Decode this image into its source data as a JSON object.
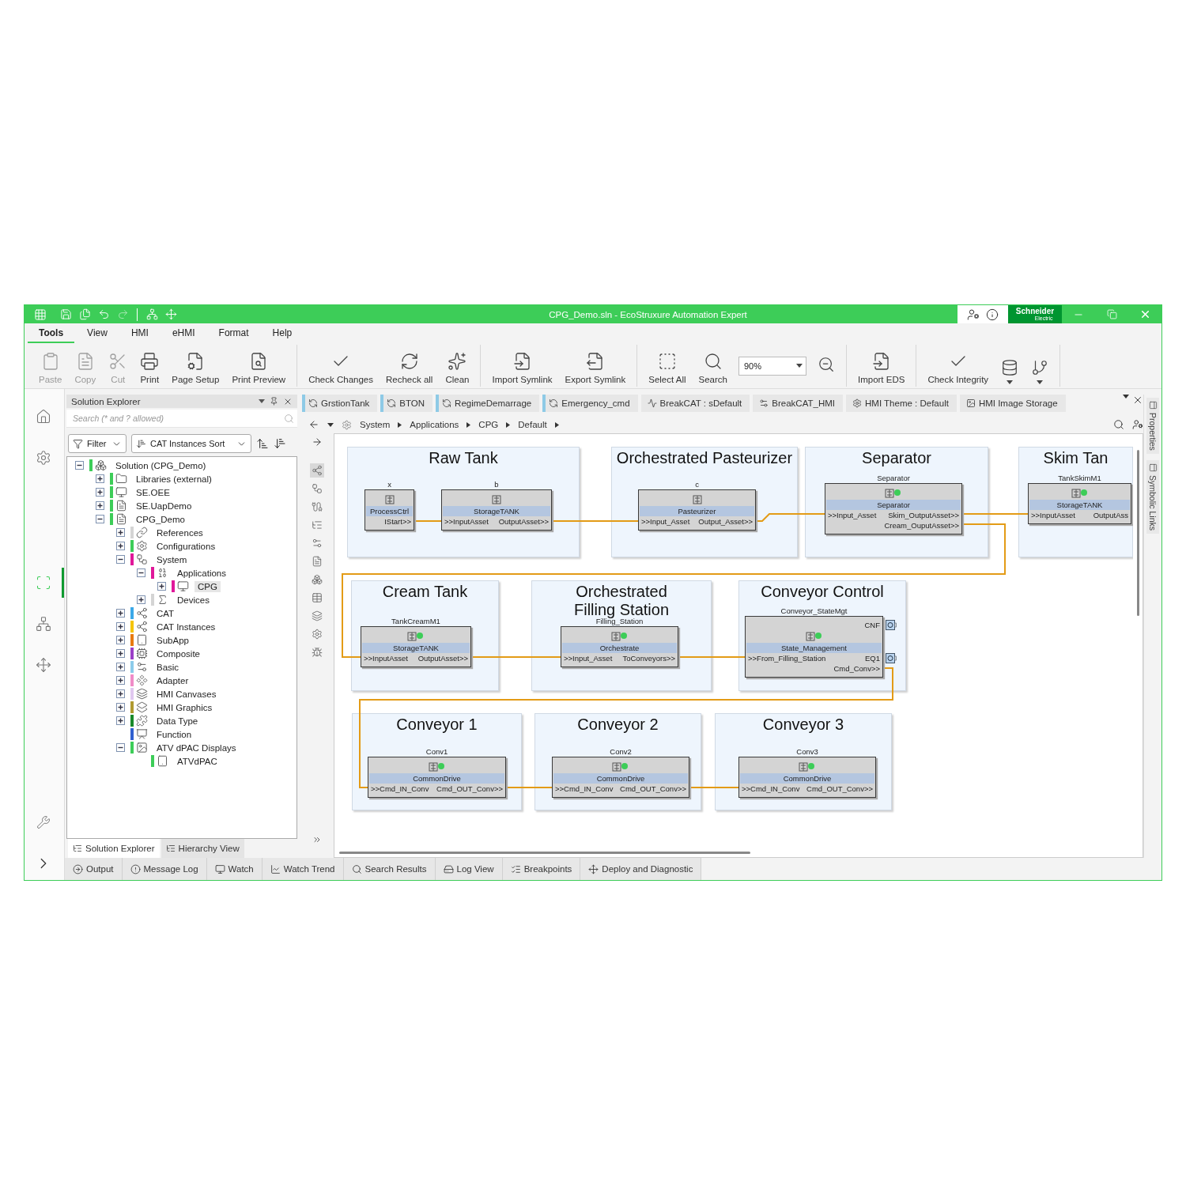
{
  "window": {
    "title": "CPG_Demo.sln - EcoStruxure Automation Expert",
    "brand": "Schneider",
    "brand_sub": "Electric"
  },
  "menu": [
    {
      "label": "Tools",
      "selected": true
    },
    {
      "label": "View",
      "selected": false
    },
    {
      "label": "HMI",
      "selected": false
    },
    {
      "label": "eHMI",
      "selected": false
    },
    {
      "label": "Format",
      "selected": false
    },
    {
      "label": "Help",
      "selected": false
    }
  ],
  "ribbon": [
    {
      "items": [
        {
          "kind": "button",
          "label": "Paste",
          "disabled": true
        },
        {
          "kind": "button",
          "label": "Copy",
          "disabled": true
        },
        {
          "kind": "button",
          "label": "Cut",
          "disabled": true
        },
        {
          "kind": "button",
          "label": "Print",
          "disabled": false
        },
        {
          "kind": "button",
          "label": "Page Setup",
          "disabled": false
        },
        {
          "kind": "button",
          "label": "Print Preview",
          "disabled": false
        }
      ]
    },
    {
      "items": [
        {
          "kind": "button",
          "label": "Check Changes",
          "disabled": false
        },
        {
          "kind": "button",
          "label": "Recheck all",
          "disabled": false
        },
        {
          "kind": "button",
          "label": "Clean",
          "disabled": false
        }
      ]
    },
    {
      "items": [
        {
          "kind": "button",
          "label": "Import Symlink",
          "disabled": false
        },
        {
          "kind": "button",
          "label": "Export Symlink",
          "disabled": false
        }
      ]
    },
    {
      "items": [
        {
          "kind": "button",
          "label": "Select All",
          "disabled": false
        },
        {
          "kind": "button",
          "label": "Search",
          "disabled": false
        },
        {
          "kind": "zoom",
          "value": "90%",
          "disabled": false
        },
        {
          "kind": "icon",
          "disabled": false
        }
      ]
    },
    {
      "items": [
        {
          "kind": "button",
          "label": "Import EDS",
          "disabled": false
        }
      ]
    },
    {
      "items": [
        {
          "kind": "button",
          "label": "Check Integrity",
          "disabled": false
        },
        {
          "kind": "dropdown",
          "disabled": false
        },
        {
          "kind": "dropdown",
          "disabled": false
        }
      ]
    }
  ],
  "nav_rail": [
    {
      "selected": false
    },
    {
      "selected": false
    },
    {
      "selected": true
    },
    {
      "selected": false
    },
    {
      "selected": false
    }
  ],
  "explorer": {
    "title": "Solution Explorer",
    "search": {
      "placeholder": "Search (* and ? allowed)"
    },
    "filter": "Filter",
    "sort": "CAT Instances Sort",
    "tree": [
      {
        "label": "Solution  (CPG_Demo)",
        "kind": "group",
        "expanded": true,
        "selected": false,
        "color": "#3dcd58",
        "children": [
          {
            "label": "Libraries (external)",
            "kind": "group",
            "expanded": false,
            "selected": false,
            "color": "#3dcd58"
          },
          {
            "label": "SE.OEE",
            "kind": "group",
            "expanded": false,
            "selected": false,
            "color": "#3dcd58"
          },
          {
            "label": "SE.UapDemo",
            "kind": "group",
            "expanded": false,
            "selected": false,
            "color": "#3dcd58"
          },
          {
            "label": "CPG_Demo",
            "kind": "group",
            "expanded": true,
            "selected": false,
            "color": "#3dcd58",
            "children": [
              {
                "label": "References",
                "kind": "group",
                "expanded": false,
                "selected": false,
                "color": "#d4d4d4"
              },
              {
                "label": "Configurations",
                "kind": "group",
                "expanded": false,
                "selected": false,
                "color": "#3dcd58"
              },
              {
                "label": "System",
                "kind": "group",
                "expanded": true,
                "selected": false,
                "color": "#e0189a",
                "children": [
                  {
                    "label": "Applications",
                    "kind": "group",
                    "expanded": true,
                    "selected": false,
                    "color": "#e0189a",
                    "children": [
                      {
                        "label": "CPG",
                        "kind": "group",
                        "expanded": false,
                        "selected": true,
                        "color": "#e0189a"
                      }
                    ]
                  },
                  {
                    "label": "Devices",
                    "kind": "group",
                    "expanded": false,
                    "selected": false,
                    "color": "#d4d4d4"
                  }
                ]
              },
              {
                "label": "CAT",
                "kind": "group",
                "expanded": false,
                "selected": false,
                "color": "#3aa8e8"
              },
              {
                "label": "CAT Instances",
                "kind": "group",
                "expanded": false,
                "selected": false,
                "color": "#f5c400"
              },
              {
                "label": "SubApp",
                "kind": "group",
                "expanded": false,
                "selected": false,
                "color": "#e87a10"
              },
              {
                "label": "Composite",
                "kind": "group",
                "expanded": false,
                "selected": false,
                "color": "#9b3fc8"
              },
              {
                "label": "Basic",
                "kind": "group",
                "expanded": false,
                "selected": false,
                "color": "#8ccbea"
              },
              {
                "label": "Adapter",
                "kind": "group",
                "expanded": false,
                "selected": false,
                "color": "#f08cc8"
              },
              {
                "label": "HMI Canvases",
                "kind": "group",
                "expanded": false,
                "selected": false,
                "color": "#e0c8f0"
              },
              {
                "label": "HMI Graphics",
                "kind": "group",
                "expanded": false,
                "selected": false,
                "color": "#b09a30"
              },
              {
                "label": "Data Type",
                "kind": "group",
                "expanded": false,
                "selected": false,
                "color": "#1a8a2a"
              },
              {
                "label": "Function",
                "kind": "leaf",
                "selected": false,
                "color": "#3060d0"
              },
              {
                "label": "ATV dPAC Displays",
                "kind": "group",
                "expanded": true,
                "selected": false,
                "color": "#3dcd58",
                "children": [
                  {
                    "label": "ATVdPAC",
                    "kind": "leaf",
                    "selected": false,
                    "color": "#3dcd58"
                  }
                ]
              }
            ]
          }
        ]
      }
    ],
    "tabs": [
      {
        "label": "Solution Explorer",
        "selected": true
      },
      {
        "label": "Hierarchy View",
        "selected": false
      }
    ]
  },
  "document_tabs": [
    {
      "label": "GrstionTank",
      "color": "#8ecae6"
    },
    {
      "label": "BTON",
      "color": "#8ecae6"
    },
    {
      "label": "RegimeDemarrage",
      "color": "#8ecae6"
    },
    {
      "label": "Emergency_cmd",
      "color": "#8ecae6"
    },
    {
      "label": "BreakCAT : sDefault"
    },
    {
      "label": "BreakCAT_HMI"
    },
    {
      "label": "HMI Theme : Default"
    },
    {
      "label": "HMI Image Storage"
    }
  ],
  "breadcrumb": [
    "System",
    "Applications",
    "CPG",
    "Default"
  ],
  "diagram": {
    "groups": [
      {
        "title": "Raw Tank",
        "blocks": [
          {
            "instance": "x",
            "type": "ProcessCtrl",
            "ok": false,
            "outputs": [
              "IStart>>"
            ]
          },
          {
            "instance": "b",
            "type": "StorageTANK",
            "ok": false,
            "inputs": [
              ">>InputAsset"
            ],
            "outputs": [
              "OutputAsset>>"
            ]
          }
        ]
      },
      {
        "title": "Orchestrated Pasteurizer",
        "blocks": [
          {
            "instance": "c",
            "type": "Pasteurizer",
            "ok": false,
            "inputs": [
              ">>Input_Asset"
            ],
            "outputs": [
              "Output_Asset>>"
            ]
          }
        ]
      },
      {
        "title": "Separator",
        "blocks": [
          {
            "instance": "Separator",
            "type": "Separator",
            "ok": true,
            "inputs": [
              ">>Input_Asset"
            ],
            "outputs": [
              "Skim_OutputAsset>>",
              "Cream_OuputAsset>>"
            ]
          }
        ]
      },
      {
        "title": "Skim Tan",
        "blocks": [
          {
            "instance": "TankSkimM1",
            "type": "StorageTANK",
            "ok": true,
            "inputs": [
              ">>InputAsset"
            ],
            "outputs": [
              "OutputAss"
            ]
          }
        ]
      },
      {
        "title": "Cream Tank",
        "blocks": [
          {
            "instance": "TankCreamM1",
            "type": "StorageTANK",
            "ok": true,
            "inputs": [
              ">>InputAsset"
            ],
            "outputs": [
              "OutputAsset>>"
            ]
          }
        ]
      },
      {
        "title": "Orchestrated Filling Station",
        "blocks": [
          {
            "instance": "Filling_Station",
            "type": "Orchestrate",
            "ok": true,
            "inputs": [
              ">>Input_Asset"
            ],
            "outputs": [
              "ToConveyors>>"
            ]
          }
        ]
      },
      {
        "title": "Conveyor Control",
        "blocks": [
          {
            "instance": "Conveyor_StateMgt",
            "type": "State_Management",
            "ok": true,
            "adapter_outputs": [
              "CNF",
              "EQ1"
            ],
            "inputs": [
              ">>From_Filling_Station"
            ],
            "outputs": [
              "Cmd_Conv>>"
            ]
          }
        ]
      },
      {
        "title": "Conveyor 1",
        "blocks": [
          {
            "instance": "Conv1",
            "type": "CommonDrive",
            "ok": true,
            "inputs": [
              ">>Cmd_IN_Conv"
            ],
            "outputs": [
              "Cmd_OUT_Conv>>"
            ]
          }
        ]
      },
      {
        "title": "Conveyor 2",
        "blocks": [
          {
            "instance": "Conv2",
            "type": "CommonDrive",
            "ok": true,
            "inputs": [
              ">>Cmd_IN_Conv"
            ],
            "outputs": [
              "Cmd_OUT_Conv>>"
            ]
          }
        ]
      },
      {
        "title": "Conveyor 3",
        "blocks": [
          {
            "instance": "Conv3",
            "type": "CommonDrive",
            "ok": true,
            "inputs": [
              ">>Cmd_IN_Conv"
            ],
            "outputs": [
              "Cmd_OUT_Conv>>"
            ]
          }
        ]
      }
    ]
  },
  "side_panels": [
    "Properties",
    "Symbolic Links"
  ],
  "bottom_tabs": [
    "Output",
    "Message Log",
    "Watch",
    "Watch Trend",
    "Search Results",
    "Log View",
    "Breakpoints",
    "Deploy and Diagnostic"
  ]
}
